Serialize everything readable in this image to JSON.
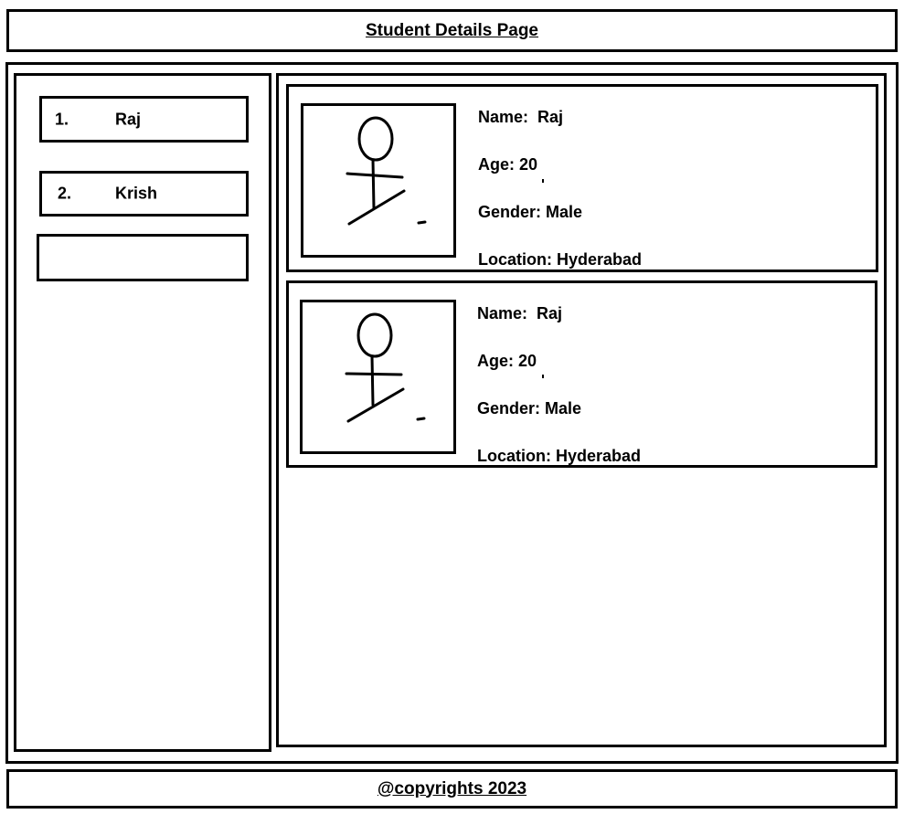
{
  "header": {
    "title": "Student Details Page"
  },
  "sidebar": {
    "items": [
      {
        "number": "1.",
        "label": "Raj"
      },
      {
        "number": "2.",
        "label": "Krish"
      },
      {
        "number": "",
        "label": ""
      }
    ]
  },
  "students": [
    {
      "avatar_icon": "stick-figure-icon",
      "name_label": "Name:",
      "name": "Raj",
      "age_label": "Age:",
      "age": "20",
      "gender_label": "Gender:",
      "gender": "Male",
      "location_label": "Location:",
      "location": "Hyderabad"
    },
    {
      "avatar_icon": "stick-figure-icon",
      "name_label": "Name:",
      "name": "Raj",
      "age_label": "Age:",
      "age": "20",
      "gender_label": "Gender:",
      "gender": "Male",
      "location_label": "Location:",
      "location": "Hyderabad"
    }
  ],
  "footer": {
    "text": "@copyrights 2023"
  }
}
